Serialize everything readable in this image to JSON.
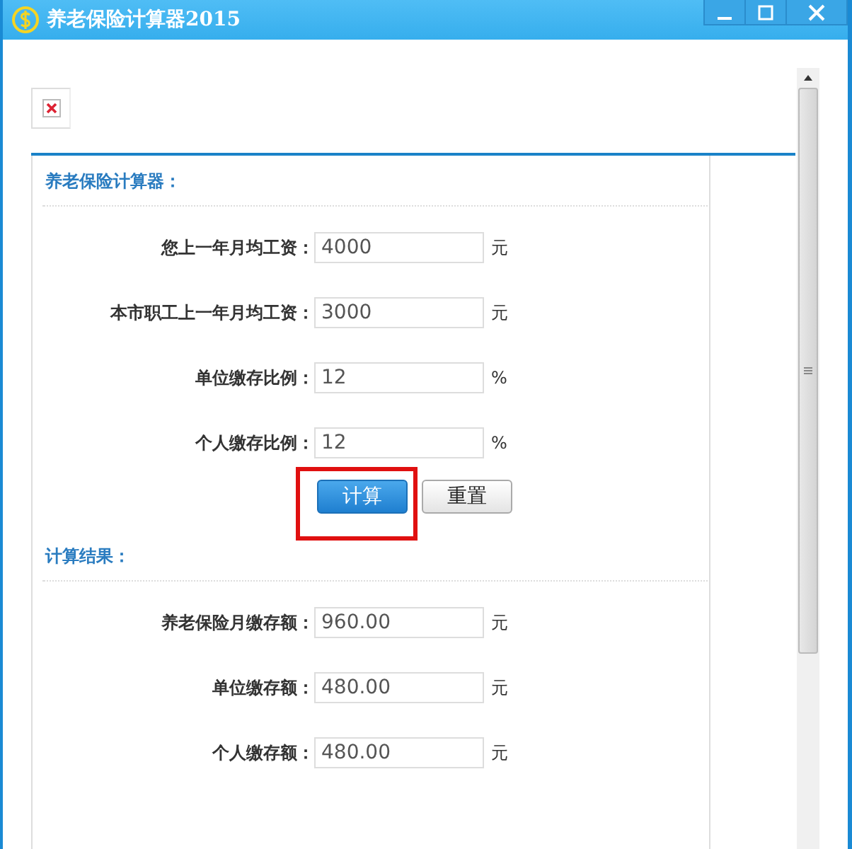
{
  "window": {
    "title": "养老保险计算器2015"
  },
  "input_section": {
    "title": "养老保险计算器：",
    "fields": [
      {
        "label": "您上一年月均工资：",
        "value": "4000",
        "unit": "元"
      },
      {
        "label": "本市职工上一年月均工资：",
        "value": "3000",
        "unit": "元"
      },
      {
        "label": "单位缴存比例：",
        "value": "12",
        "unit": "%"
      },
      {
        "label": "个人缴存比例：",
        "value": "12",
        "unit": "%"
      }
    ]
  },
  "buttons": [
    {
      "label": "计算",
      "kind": "primary",
      "highlighted": true
    },
    {
      "label": "重置",
      "kind": "secondary",
      "highlighted": false
    }
  ],
  "result_section": {
    "title": "计算结果：",
    "fields": [
      {
        "label": "养老保险月缴存额：",
        "value": "960.00",
        "unit": "元"
      },
      {
        "label": "单位缴存额：",
        "value": "480.00",
        "unit": "元"
      },
      {
        "label": "个人缴存额：",
        "value": "480.00",
        "unit": "元"
      }
    ]
  }
}
